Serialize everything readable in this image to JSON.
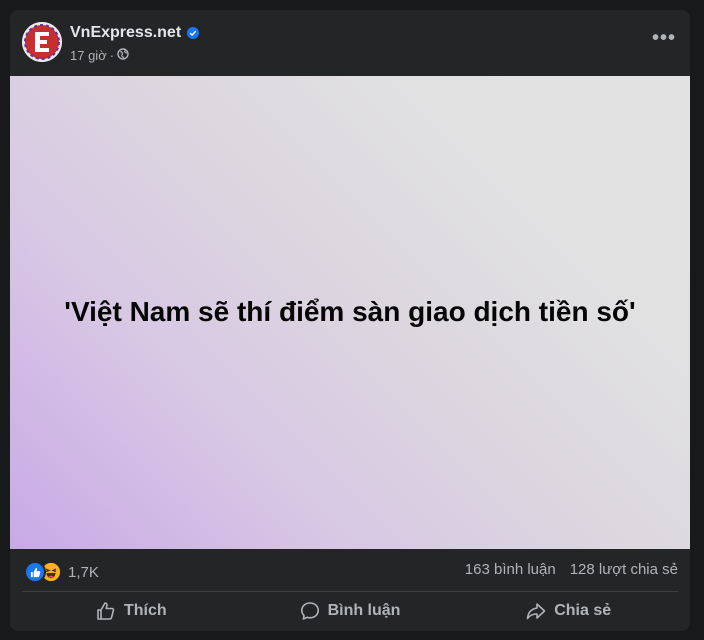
{
  "post": {
    "page_name": "VnExpress.net",
    "time": "17 giờ",
    "separator": "·",
    "headline": "'Việt Nam sẽ thí điểm sàn giao dịch tiền số'",
    "more_label": "•••"
  },
  "stats": {
    "reaction_count": "1,7K",
    "comments": "163 bình luận",
    "shares": "128 lượt chia sẻ",
    "reactions": [
      "like-icon",
      "haha-icon"
    ]
  },
  "actions": {
    "like": "Thích",
    "comment": "Bình luận",
    "share": "Chia sẻ"
  },
  "colors": {
    "brand_red": "#c5302f",
    "like_blue": "#1877f2",
    "haha_yellow": "#f7b125"
  }
}
